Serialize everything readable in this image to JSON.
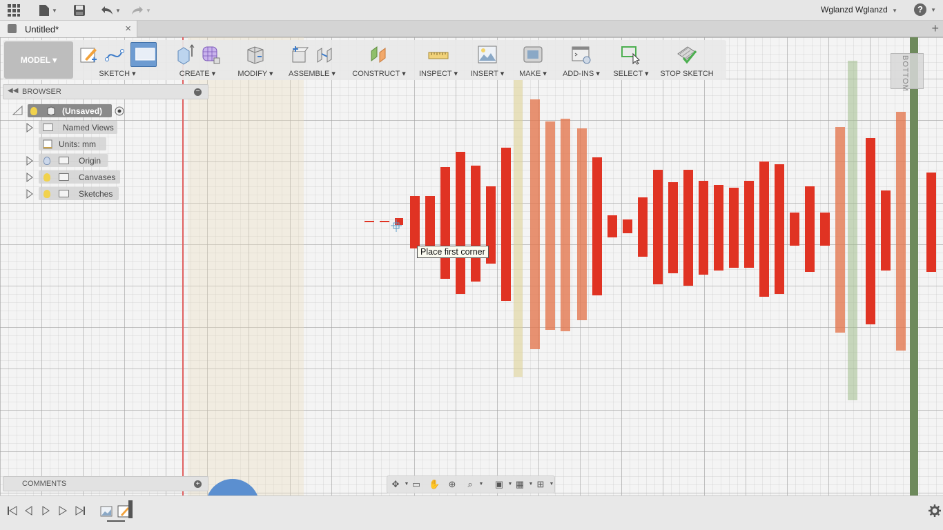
{
  "appbar": {
    "user_name": "Wglanzd Wglanzd",
    "help_label": "?"
  },
  "document_tab": {
    "title": "Untitled*",
    "close_glyph": "×",
    "new_tab_glyph": "+"
  },
  "toolbar": {
    "workspace": "MODEL ▾",
    "groups": [
      {
        "label": "SKETCH ▾",
        "icons": [
          "create-sketch-icon",
          "spline-icon",
          "rectangle-icon"
        ]
      },
      {
        "label": "CREATE ▾",
        "icons": [
          "extrude-box-icon",
          "form-icon"
        ]
      },
      {
        "label": "MODIFY ▾",
        "icons": [
          "press-pull-icon"
        ]
      },
      {
        "label": "ASSEMBLE ▾",
        "icons": [
          "new-component-icon",
          "joint-icon"
        ]
      },
      {
        "label": "CONSTRUCT ▾",
        "icons": [
          "offset-plane-icon"
        ]
      },
      {
        "label": "INSPECT ▾",
        "icons": [
          "measure-icon"
        ]
      },
      {
        "label": "INSERT ▾",
        "icons": [
          "insert-image-icon"
        ]
      },
      {
        "label": "MAKE ▾",
        "icons": [
          "print-icon"
        ]
      },
      {
        "label": "ADD-INS ▾",
        "icons": [
          "scripts-icon"
        ]
      },
      {
        "label": "SELECT ▾",
        "icons": [
          "select-icon"
        ]
      },
      {
        "label": "STOP SKETCH",
        "icons": [
          "stop-sketch-icon"
        ]
      }
    ]
  },
  "browser": {
    "title": "BROWSER",
    "root": "(Unsaved)",
    "items": [
      {
        "label": "Named Views"
      },
      {
        "label": "Units: mm"
      },
      {
        "label": "Origin"
      },
      {
        "label": "Canvases"
      },
      {
        "label": "Sketches"
      }
    ]
  },
  "comments": {
    "title": "COMMENTS"
  },
  "canvas": {
    "tooltip": "Place first corner",
    "viewcube_label": "BOTTOM"
  },
  "colors": {
    "accent_blue": "#6d9bd1",
    "bar_red": "#e03323",
    "bar_salmon": "#e8805f",
    "axis_red": "#e06060",
    "axis_green": "#6e8a5c"
  }
}
